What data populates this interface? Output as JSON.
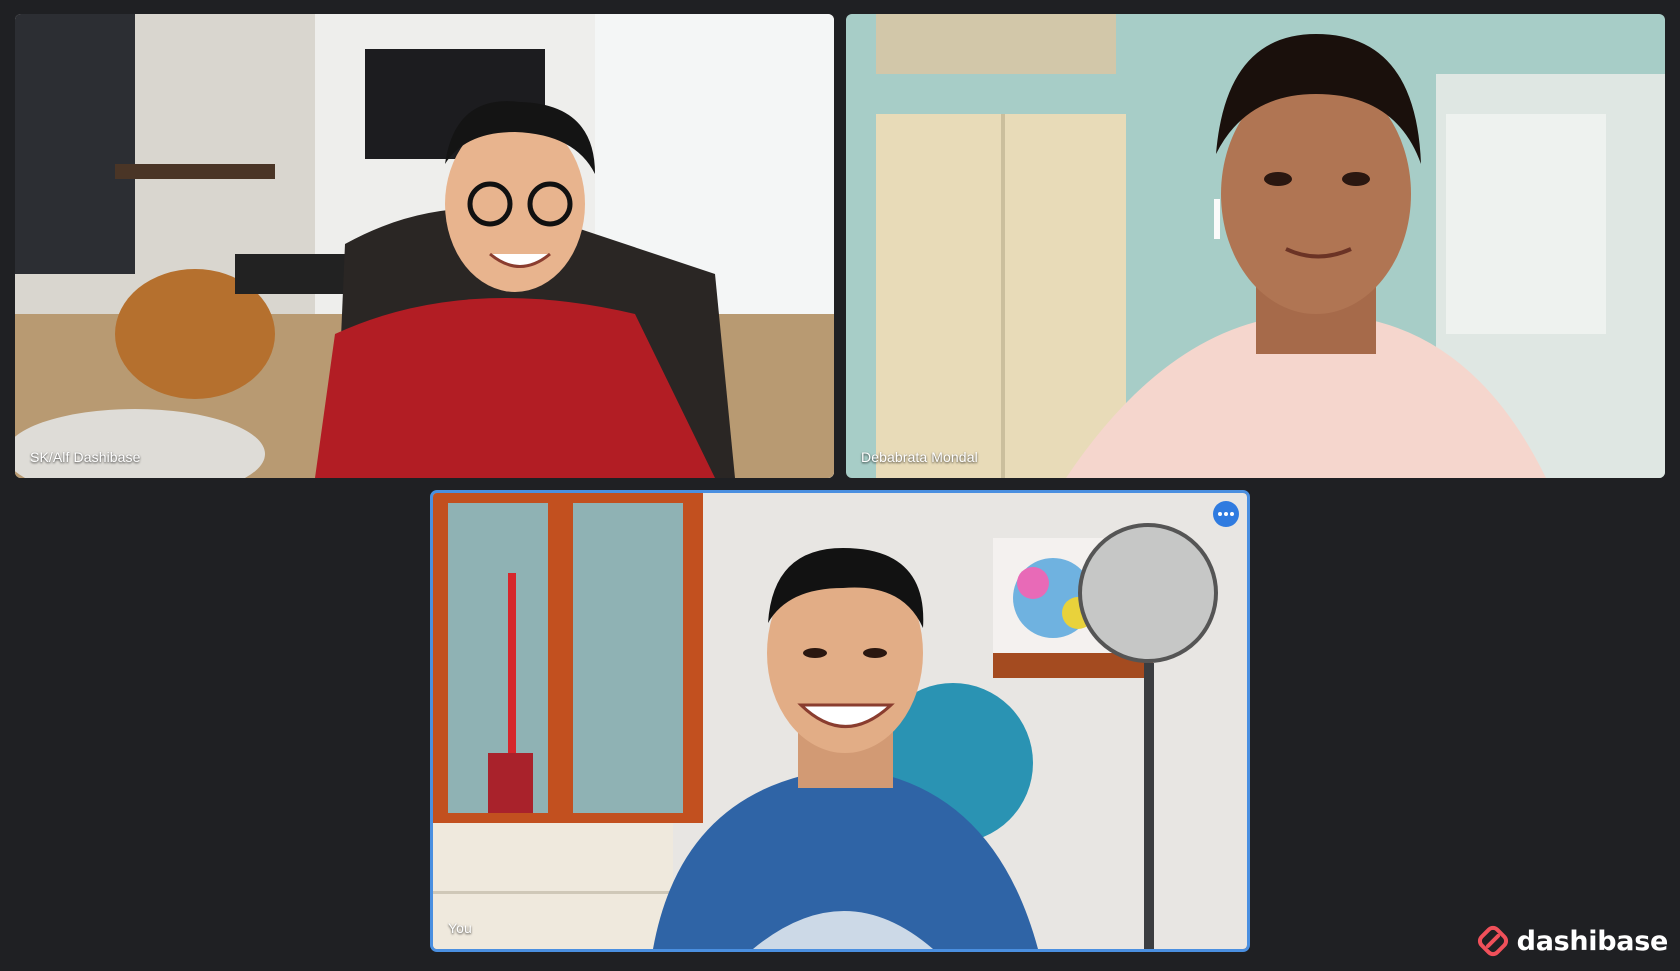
{
  "participants": [
    {
      "name": "SK/Alf Dashibase"
    },
    {
      "name": "Debabrata Mondal"
    },
    {
      "name": "You"
    }
  ],
  "brand": {
    "name": "dashibase",
    "color": "#f0505a"
  },
  "colors": {
    "background": "#1f2023",
    "active_border": "#4a8fe0",
    "more_button": "#2f7be0"
  },
  "icons": {
    "more": "more-horizontal-icon",
    "logo": "dashibase-logo-icon"
  }
}
